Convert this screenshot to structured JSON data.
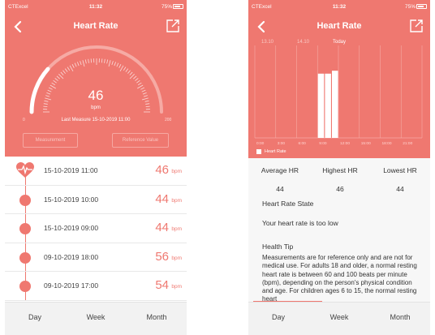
{
  "status_bar": {
    "carrier": "CTExcel",
    "time": "11:32",
    "battery": "75%"
  },
  "left_screen": {
    "title": "Heart Rate",
    "gauge": {
      "value": "46",
      "unit": "bpm",
      "min": "0",
      "max": "200",
      "fill_fraction": 0.23
    },
    "last_measure": "Last Measure   15-10-2019 11:00",
    "buttons": [
      "Measurement",
      "Reference Value"
    ],
    "records": [
      {
        "date": "15-10-2019 11:00",
        "value": "46",
        "unit": "bpm",
        "icon": "heart-pulse-icon"
      },
      {
        "date": "15-10-2019 10:00",
        "value": "44",
        "unit": "bpm",
        "icon": "dot"
      },
      {
        "date": "15-10-2019 09:00",
        "value": "44",
        "unit": "bpm",
        "icon": "dot"
      },
      {
        "date": "09-10-2019 18:00",
        "value": "56",
        "unit": "bpm",
        "icon": "dot"
      },
      {
        "date": "09-10-2019 17:00",
        "value": "54",
        "unit": "bpm",
        "icon": "dot"
      }
    ],
    "tabs": [
      "Day",
      "Week",
      "Month"
    ]
  },
  "right_screen": {
    "title": "Heart Rate",
    "date_chips": [
      "13.10",
      "14.10",
      "Today"
    ],
    "chart_data": {
      "type": "bar",
      "categories": [
        "0:00",
        "3:00",
        "6:00",
        "9:00",
        "12:00",
        "15:00",
        "18:00",
        "21:00"
      ],
      "x_tick_labels": [
        "0:00",
        "3:00",
        "6:00",
        "9:00",
        "12:00",
        "15:00",
        "18:00",
        "21:00"
      ],
      "bars": [
        {
          "hour": 9.0,
          "value": 44
        },
        {
          "hour": 10.0,
          "value": 44
        },
        {
          "hour": 11.0,
          "value": 46
        }
      ],
      "ylim": [
        0,
        60
      ],
      "legend": [
        "Heart Rate"
      ],
      "legend_position": "bottom-left",
      "grid": true
    },
    "stats": {
      "labels": [
        "Average HR",
        "Highest HR",
        "Lowest HR"
      ],
      "values": [
        "44",
        "46",
        "44"
      ]
    },
    "state_title": "Heart Rate State",
    "state_text": "Your heart rate is too low",
    "tip_title": "Health Tip",
    "tip_text": "Measurements are for reference only and are not for medical use. For adults 18 and older, a normal resting heart rate is between 60 and 100 beats per minute (bpm), depending on the person's physical condition and age. For children ages 6 to 15, the normal resting heart",
    "tabs": [
      "Day",
      "Week",
      "Month"
    ]
  },
  "colors": {
    "accent": "#ef7870",
    "panel_bg": "#f7f7f7",
    "tab_bg": "#f2f2f2"
  }
}
